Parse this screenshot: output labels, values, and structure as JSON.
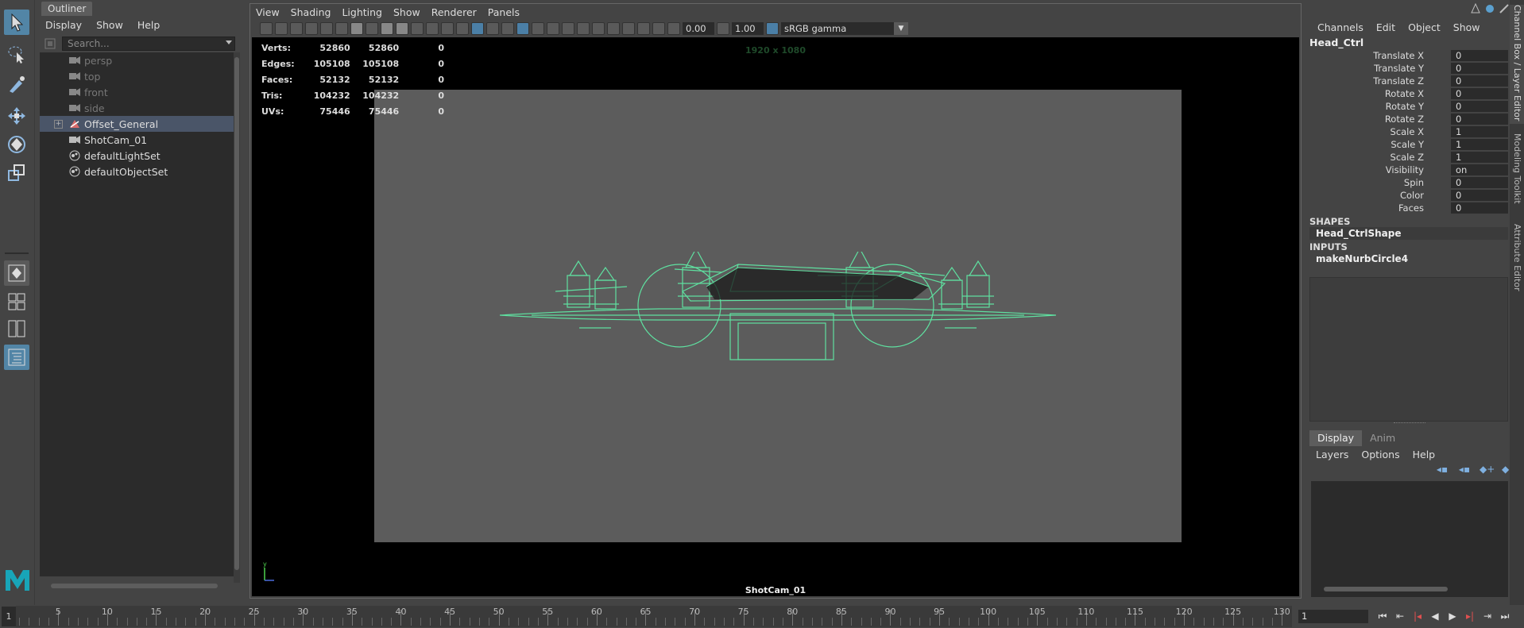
{
  "outliner": {
    "tab": "Outliner",
    "menu": [
      "Display",
      "Show",
      "Help"
    ],
    "search_placeholder": "Search...",
    "items": [
      {
        "label": "persp",
        "dim": true,
        "icon": "camera-icon"
      },
      {
        "label": "top",
        "dim": true,
        "icon": "camera-icon"
      },
      {
        "label": "front",
        "dim": true,
        "icon": "camera-icon"
      },
      {
        "label": "side",
        "dim": true,
        "icon": "camera-icon"
      },
      {
        "label": "Offset_General",
        "dim": false,
        "icon": "transform-icon",
        "selected": true,
        "expandable": true,
        "expand_glyph": "+"
      },
      {
        "label": "ShotCam_01",
        "dim": false,
        "icon": "camera-icon"
      },
      {
        "label": "defaultLightSet",
        "dim": false,
        "icon": "set-icon"
      },
      {
        "label": "defaultObjectSet",
        "dim": false,
        "icon": "set-icon"
      }
    ]
  },
  "viewport": {
    "menu": [
      "View",
      "Shading",
      "Lighting",
      "Show",
      "Renderer",
      "Panels"
    ],
    "exposure": "0.00",
    "gamma": "1.00",
    "color_space": "sRGB gamma",
    "resolution": "1920 x 1080",
    "camera": "ShotCam_01",
    "hud": {
      "rows": [
        {
          "label": "Verts:",
          "a": "52860",
          "b": "52860",
          "c": "0"
        },
        {
          "label": "Edges:",
          "a": "105108",
          "b": "105108",
          "c": "0"
        },
        {
          "label": "Faces:",
          "a": "52132",
          "b": "52132",
          "c": "0"
        },
        {
          "label": "Tris:",
          "a": "104232",
          "b": "104232",
          "c": "0"
        },
        {
          "label": "UVs:",
          "a": "75446",
          "b": "75446",
          "c": "0"
        }
      ]
    },
    "wire_color": "#5fe0a0",
    "axis_y": "y"
  },
  "channel_box": {
    "menu": [
      "Channels",
      "Edit",
      "Object",
      "Show"
    ],
    "object": "Head_Ctrl",
    "attributes": [
      {
        "name": "Translate X",
        "value": "0"
      },
      {
        "name": "Translate Y",
        "value": "0"
      },
      {
        "name": "Translate Z",
        "value": "0"
      },
      {
        "name": "Rotate X",
        "value": "0"
      },
      {
        "name": "Rotate Y",
        "value": "0"
      },
      {
        "name": "Rotate Z",
        "value": "0"
      },
      {
        "name": "Scale X",
        "value": "1"
      },
      {
        "name": "Scale Y",
        "value": "1"
      },
      {
        "name": "Scale Z",
        "value": "1"
      },
      {
        "name": "Visibility",
        "value": "on"
      },
      {
        "name": "Spin",
        "value": "0"
      },
      {
        "name": "Color",
        "value": "0"
      },
      {
        "name": "Faces",
        "value": "0"
      }
    ],
    "shapes_header": "SHAPES",
    "shape": "Head_CtrlShape",
    "inputs_header": "INPUTS",
    "input": "makeNurbCircle4"
  },
  "layer_editor": {
    "tabs": [
      "Display",
      "Anim"
    ],
    "menu": [
      "Layers",
      "Options",
      "Help"
    ]
  },
  "side_tabs": [
    "Channel Box / Layer Editor",
    "Modeling Toolkit",
    "Attribute Editor"
  ],
  "timeline": {
    "current_frame_marker": "1",
    "labels": [
      "5",
      "10",
      "15",
      "20",
      "25",
      "30",
      "35",
      "40",
      "45",
      "50",
      "55",
      "60",
      "65",
      "70",
      "75",
      "80",
      "85",
      "90",
      "95",
      "100",
      "105",
      "110",
      "115",
      "120",
      "125",
      "130"
    ],
    "current_frame": "1"
  }
}
